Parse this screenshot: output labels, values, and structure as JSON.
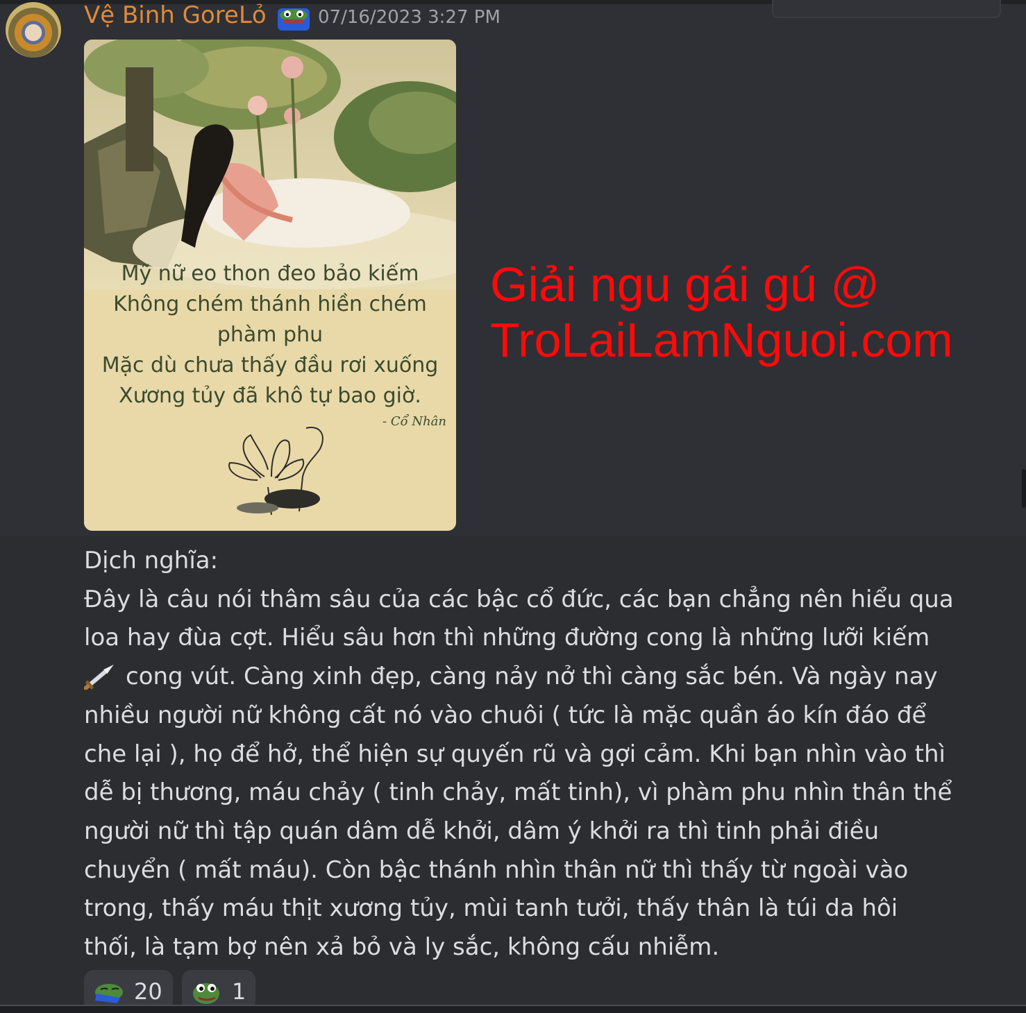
{
  "message": {
    "author": "Vệ Binh GoreLỏ",
    "timestamp": "07/16/2023 3:27 PM",
    "text_lines": [
      "Dịch nghĩa:",
      "Đây là câu nói thâm sâu của các bậc cổ đức, các bạn chẳng nên hiểu qua",
      "loa hay đùa cợt. Hiểu sâu hơn thì những đường cong là những lưỡi kiếm",
      "cong vút. Càng xinh đẹp, càng nảy nở thì càng sắc bén. Và ngày nay",
      "nhiều người nữ không cất nó vào chuôi ( tức là mặc quần áo kín đáo để",
      "che lại ), họ để hở, thể hiện sự quyến rũ và gợi cảm. Khi bạn nhìn vào thì",
      "dễ bị thương, máu chảy ( tinh chảy, mất tinh), vì phàm phu nhìn thân thể",
      "người nữ thì tập quán dâm dễ khởi, dâm ý khởi ra thì tinh phải điều",
      "chuyển ( mất máu). Còn bậc thánh nhìn thân nữ thì thấy từ ngoài vào",
      "trong, thấy máu thịt xương tủy, mùi tanh tưởi, thấy thân là túi da hôi",
      "thối, là tạm bợ nên xả bỏ và ly sắc, không cấu nhiễm."
    ],
    "inline_emoji": "dagger-emoji"
  },
  "attachment": {
    "poem_lines": [
      "Mỹ nữ eo thon đeo bảo kiếm",
      "Không chém thánh hiền chém",
      "phàm phu",
      "Mặc dù chưa thấy đầu rơi xuống",
      "Xương tủy đã khô tự bao giờ."
    ],
    "poem_author": "- Cổ Nhân"
  },
  "watermark": {
    "line1": "Giải ngu gái gú @",
    "line2": "TroLaiLamNguoi.com",
    "color": "#ff0a0a"
  },
  "reactions": [
    {
      "emoji": "pepe-sleep-emoji",
      "count": "20"
    },
    {
      "emoji": "pepe-frog-emoji",
      "count": "1"
    }
  ],
  "colors": {
    "author": "#e08a3a",
    "background": "#2b2d31",
    "text": "#dbdee1",
    "timestamp": "#a0a3aa"
  }
}
